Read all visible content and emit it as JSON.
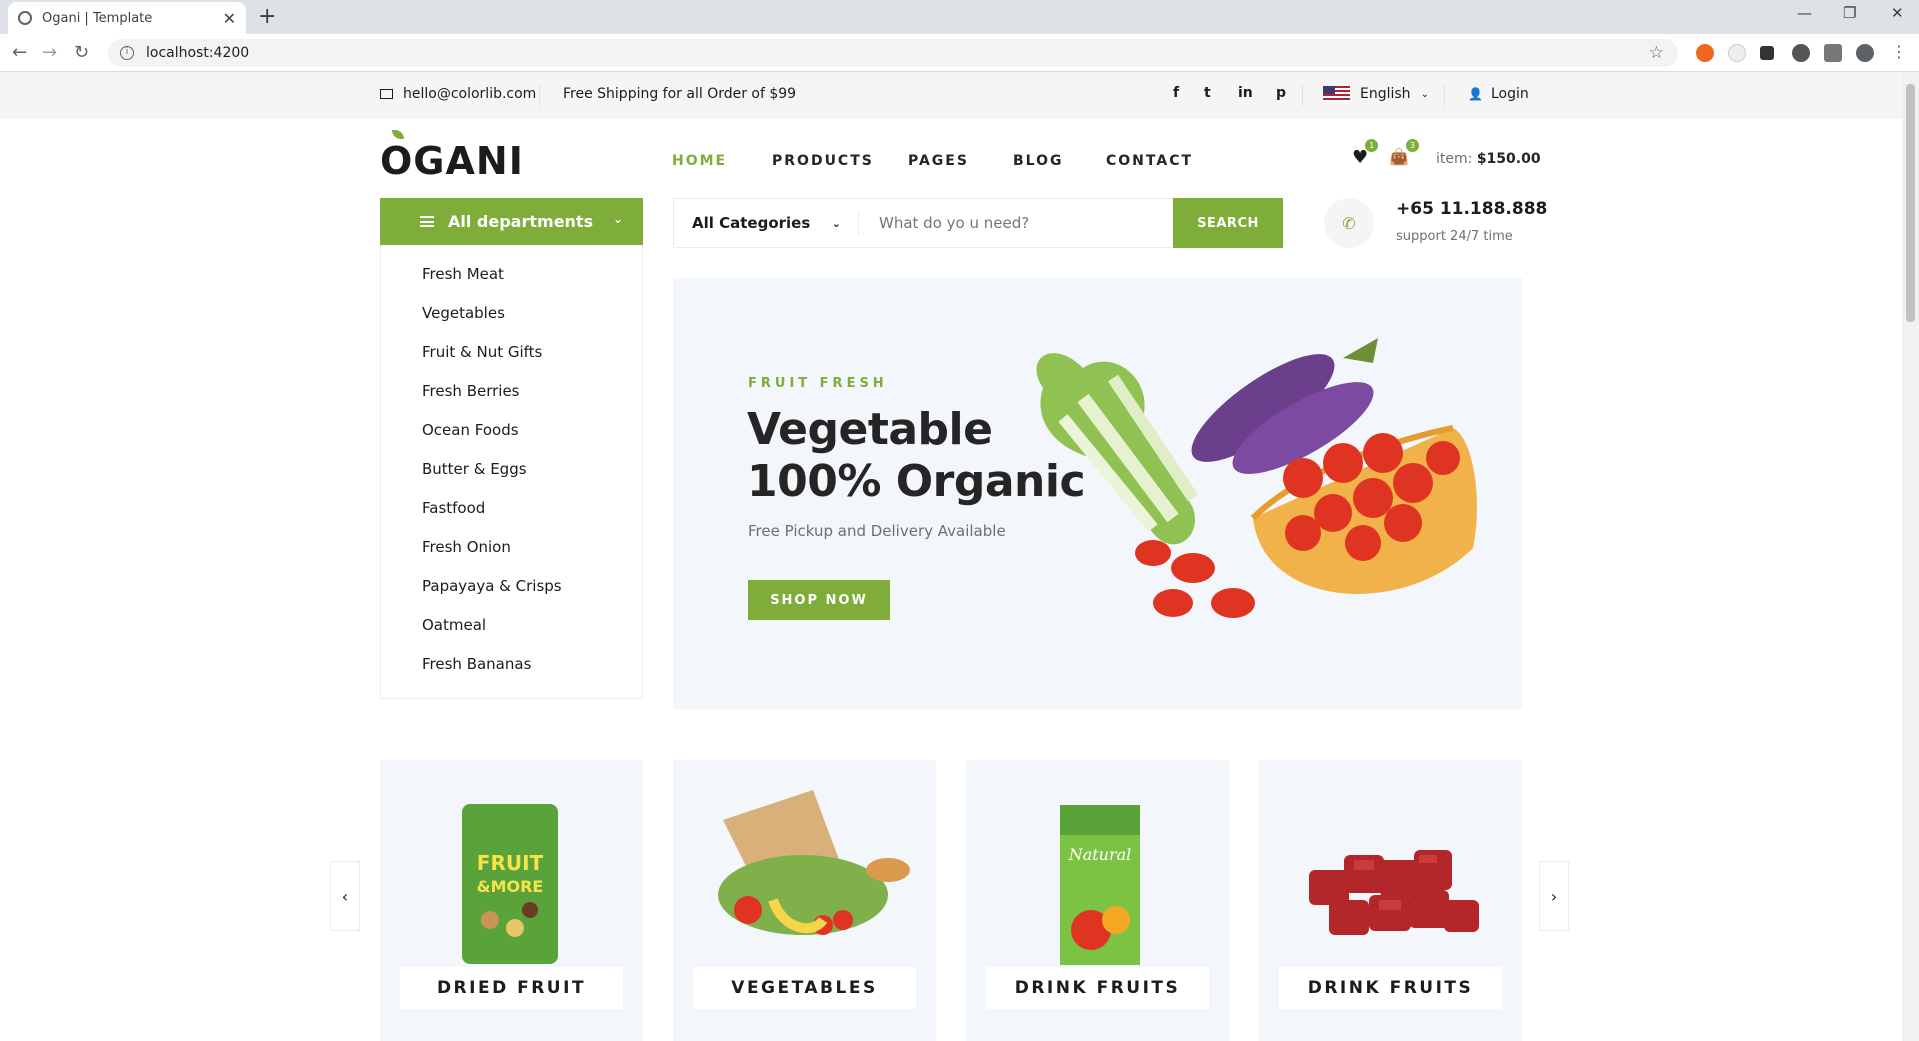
{
  "browser": {
    "tab_title": "Ogani | Template",
    "url": "localhost:4200"
  },
  "topbar": {
    "email": "hello@colorlib.com",
    "shipping": "Free Shipping for all Order of $99",
    "social": [
      "f",
      "t",
      "in",
      "p"
    ],
    "language": "English",
    "login": "Login"
  },
  "header": {
    "logo": "OGANI",
    "menu": [
      "HOME",
      "PRODUCTS",
      "PAGES",
      "BLOG",
      "CONTACT"
    ],
    "wishlist_count": "1",
    "cart_count": "3",
    "cart_label": "item:",
    "cart_total": "$150.00"
  },
  "departments": {
    "title": "All departments",
    "items": [
      "Fresh Meat",
      "Vegetables",
      "Fruit & Nut Gifts",
      "Fresh Berries",
      "Ocean Foods",
      "Butter & Eggs",
      "Fastfood",
      "Fresh Onion",
      "Papayaya & Crisps",
      "Oatmeal",
      "Fresh Bananas"
    ]
  },
  "search": {
    "category": "All Categories",
    "placeholder": "What do yo u need?",
    "button": "SEARCH"
  },
  "phone": {
    "number": "+65 11.188.888",
    "support": "support 24/7 time"
  },
  "hero": {
    "tag": "FRUIT FRESH",
    "title_line1": "Vegetable",
    "title_line2": "100% Organic",
    "subtitle": "Free Pickup and Delivery Available",
    "button": "SHOP NOW"
  },
  "categories": [
    "DRIED FRUIT",
    "VEGETABLES",
    "DRINK FRUITS",
    "DRINK FRUITS"
  ],
  "colors": {
    "accent": "#7fad39",
    "topbar": "#f5f5f5"
  }
}
